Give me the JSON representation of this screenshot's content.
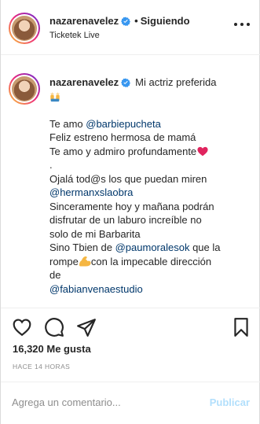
{
  "header": {
    "username": "nazarenavelez",
    "separator": "•",
    "follow_label": "Siguiendo",
    "location": "Ticketek Live"
  },
  "caption": {
    "username": "nazarenavelez",
    "first_line": "Mi actriz preferida",
    "lines": [
      {
        "pre": "Te amo ",
        "mention": "@barbiepucheta",
        "post": ""
      },
      {
        "pre": "Feliz estreno hermosa de mamá",
        "mention": "",
        "post": ""
      },
      {
        "pre": "Te amo y admiro profundamente",
        "mention": "",
        "post": ""
      },
      {
        "pre": ".",
        "mention": "",
        "post": ""
      },
      {
        "pre": "Ojalá tod@s los que puedan miren",
        "mention": "",
        "post": ""
      },
      {
        "pre": "",
        "mention": "@hermanxslaobra",
        "post": ""
      },
      {
        "pre": "Sinceramente hoy y mañana podrán",
        "mention": "",
        "post": ""
      },
      {
        "pre": "disfrutar de un laburo increíble no",
        "mention": "",
        "post": ""
      },
      {
        "pre": "solo de mi Barbarita",
        "mention": "",
        "post": ""
      },
      {
        "pre": "Sino Tbien de ",
        "mention": "@paumoralesok",
        "post": " que la"
      },
      {
        "pre": "rompe",
        "mention": "",
        "post": "con la impecable dirección"
      },
      {
        "pre": "de",
        "mention": "",
        "post": ""
      },
      {
        "pre": "",
        "mention": "@fabianvenaestudio",
        "post": ""
      }
    ]
  },
  "likes": "16,320 Me gusta",
  "timestamp": "HACE 14 HORAS",
  "comment": {
    "placeholder": "Agrega un comentario...",
    "publish_label": "Publicar"
  },
  "colors": {
    "mention": "#00376b",
    "verified": "#3897f0",
    "publish_disabled": "#b2dffc",
    "heart_emoji": "#e0245e"
  },
  "icons": [
    "verified-icon",
    "more-options-icon",
    "raising-hands-emoji-icon",
    "heart-emoji-icon",
    "flexed-biceps-emoji-icon",
    "heart-icon",
    "comment-icon",
    "share-icon",
    "bookmark-icon"
  ]
}
